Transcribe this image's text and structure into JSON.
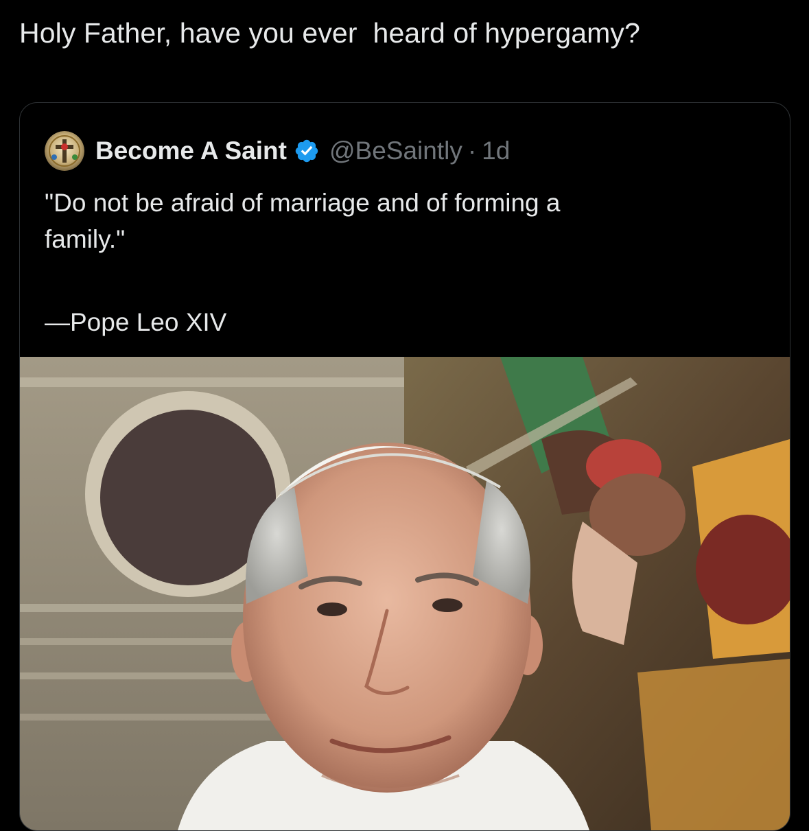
{
  "post": {
    "text": "Holy Father, have you ever  heard of hypergamy?"
  },
  "quoted_post": {
    "author_name": "Become A Saint",
    "handle": "@BeSaintly",
    "separator": "·",
    "time": "1d",
    "verified": true,
    "text_lines": [
      "\"Do not be afraid of marriage and of forming a",
      "family.\""
    ],
    "attribution": "—Pope Leo XIV",
    "avatar_icon": "saint-avatar-icon",
    "verified_icon": "verified-badge-icon",
    "media": "photo-portrait-pope"
  },
  "colors": {
    "background": "#000000",
    "text_primary": "#e7e9ea",
    "text_secondary": "#71767b",
    "border": "#2f3336",
    "verified_blue": "#1d9bf0"
  }
}
